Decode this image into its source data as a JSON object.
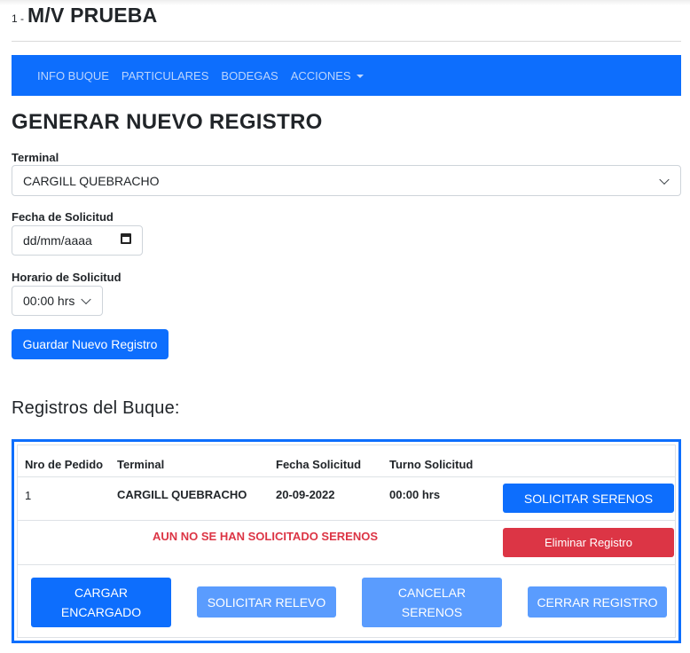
{
  "header": {
    "number": "1 -",
    "vessel_name": "M/V PRUEBA"
  },
  "nav": {
    "items": [
      "INFO BUQUE",
      "PARTICULARES",
      "BODEGAS",
      "ACCIONES"
    ]
  },
  "form": {
    "title": "GENERAR NUEVO REGISTRO",
    "terminal_label": "Terminal",
    "terminal_value": "CARGILL QUEBRACHO",
    "fecha_label": "Fecha de Solicitud",
    "fecha_placeholder": "dd/mm/aaaa",
    "horario_label": "Horario de Solicitud",
    "horario_value": "00:00 hrs",
    "save_button": "Guardar Nuevo Registro"
  },
  "registros": {
    "title": "Registros del Buque:",
    "columns": [
      "Nro de Pedido",
      "Terminal",
      "Fecha Solicitud",
      "Turno Solicitud"
    ],
    "row": {
      "nro": "1",
      "terminal": "CARGILL QUEBRACHO",
      "fecha": "20-09-2022",
      "turno": "00:00 hrs"
    },
    "solicitar_serenos": "SOLICITAR SERENOS",
    "status_text": "AUN NO SE HAN SOLICITADO SERENOS",
    "eliminar": "Eliminar Registro",
    "actions": {
      "cargar_line1": "CARGAR",
      "cargar_line2": "ENCARGADO",
      "solicitar_relevo": "SOLICITAR RELEVO",
      "cancelar_line1": "CANCELAR",
      "cancelar_line2": "SERENOS",
      "cerrar_registro": "CERRAR REGISTRO"
    }
  },
  "colors": {
    "primary": "#0d6efd",
    "danger": "#dc3545",
    "primary_light": "#5a9cfe"
  }
}
